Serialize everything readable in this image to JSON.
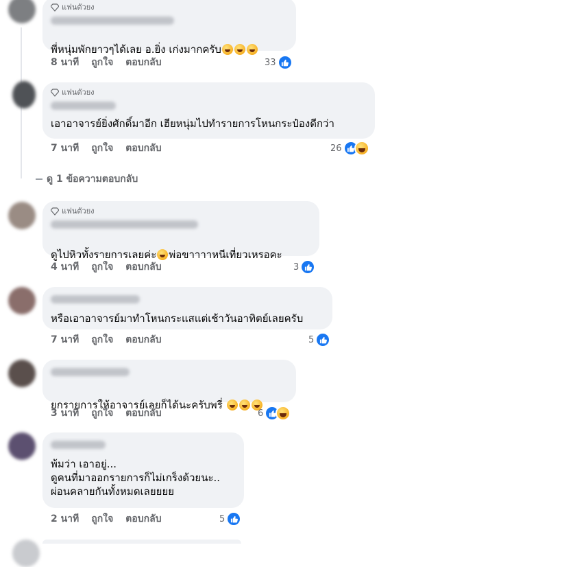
{
  "comments": [
    {
      "badge": "แฟนตัวยง",
      "text": "พี่หนุ่มพักยาวๆได้เลย อ.ยิ่ง เก่งมากครับ",
      "emoji_count": 3,
      "time": "8 นาที",
      "like_label": "ถูกใจ",
      "reply_label": "ตอบกลับ",
      "reaction_count": "33",
      "reactions": [
        "like-icon"
      ]
    },
    {
      "badge": "แฟนตัวยง",
      "text": "เอาอาจารย์ยิ่งศักดิ์มาอีก เฮียหนุ่มไปทำรายการโหนกระป๋องดีกว่า",
      "emoji_count": 0,
      "time": "7 นาที",
      "like_label": "ถูกใจ",
      "reply_label": "ตอบกลับ",
      "reaction_count": "26",
      "reactions": [
        "like-icon",
        "haha-icon"
      ]
    },
    {
      "badge": "แฟนตัวยง",
      "text_before": "ดูไปหิวทั้งรายการเลยค่ะ",
      "text_after": "พ่อขาาาาหนีเที่ยวเหรอคะ",
      "time": "4 นาที",
      "like_label": "ถูกใจ",
      "reply_label": "ตอบกลับ",
      "reaction_count": "3",
      "reactions": [
        "like-icon"
      ]
    },
    {
      "text": "หรือเอาอาจารย์มาทำโหนกระแสแต่เช้าวันอาทิตย์เลยครับ",
      "time": "7 นาที",
      "like_label": "ถูกใจ",
      "reply_label": "ตอบกลับ",
      "reaction_count": "5",
      "reactions": [
        "like-icon"
      ]
    },
    {
      "text": "ยกรายการให้อาจารย์เลยก็ได้นะครับพรี่",
      "time": "3 นาที",
      "like_label": "ถูกใจ",
      "reply_label": "ตอบกลับ",
      "reaction_count": "6",
      "reactions": [
        "like-icon",
        "haha-icon"
      ]
    },
    {
      "text": "พ้มว่า เอาอยู่...\nดูคนที่มาออกรายการก็ไม่เกร็งด้วยนะ..\nผ่อนคลายกันทั้งหมดเลยยยย",
      "time": "2 นาที",
      "like_label": "ถูกใจ",
      "reply_label": "ตอบกลับ",
      "reaction_count": "5",
      "reactions": [
        "like-icon"
      ]
    }
  ],
  "view_replies": "ดู 1 ข้อความตอบกลับ",
  "colors": {
    "bubble": "#f0f2f5",
    "meta_text": "#65676b",
    "like_blue": "#1877f2"
  }
}
